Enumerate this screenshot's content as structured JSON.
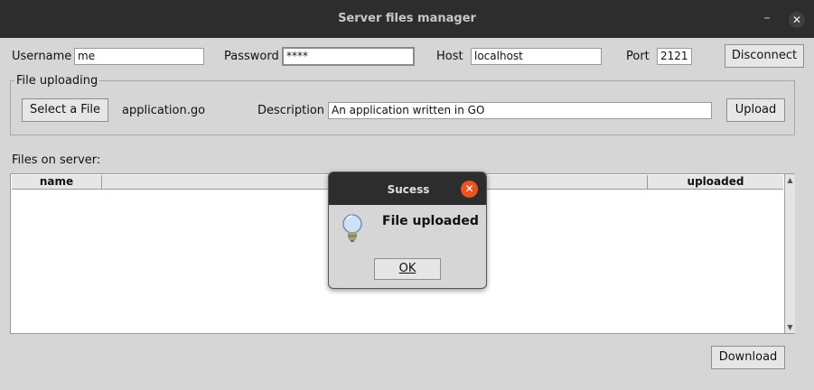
{
  "window": {
    "title": "Server files manager",
    "minimize_glyph": "–",
    "close_glyph": "✕"
  },
  "connection": {
    "username_label": "Username",
    "username_value": "me",
    "password_label": "Password",
    "password_value": "****",
    "host_label": "Host",
    "host_value": "localhost",
    "port_label": "Port",
    "port_value": "2121",
    "disconnect_label": "Disconnect"
  },
  "upload": {
    "group_label": "File uploading",
    "select_label": "Select a File",
    "selected_file": "application.go",
    "description_label": "Description",
    "description_value": "An application written in GO",
    "upload_label": "Upload"
  },
  "files": {
    "label": "Files on server:",
    "columns": [
      "name",
      "",
      "uploaded"
    ],
    "rows": []
  },
  "download_label": "Download",
  "dialog": {
    "title": "Sucess",
    "message": "File uploaded",
    "ok_label": "OK",
    "icon": "lightbulb-info-icon",
    "close_color": "#e9541f"
  }
}
